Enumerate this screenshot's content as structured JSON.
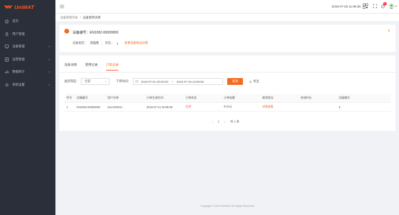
{
  "brand": {
    "name": "UniMAT",
    "color": "#ff5a1f"
  },
  "sidebar": {
    "items": [
      {
        "label": "首页",
        "icon": "home-icon",
        "has_children": false
      },
      {
        "label": "用户管理",
        "icon": "user-icon",
        "has_children": false
      },
      {
        "label": "设备管理",
        "icon": "device-icon",
        "has_children": true
      },
      {
        "label": "运营管理",
        "icon": "operation-icon",
        "has_children": true
      },
      {
        "label": "数据统计",
        "icon": "chart-icon",
        "has_children": true
      },
      {
        "label": "系统设置",
        "icon": "settings-icon",
        "has_children": true
      }
    ]
  },
  "header": {
    "datetime": "2019-07-25 11:06:36",
    "notification_count": "4"
  },
  "breadcrumb": {
    "items": [
      "设备管理列表",
      "设备使用详情"
    ]
  },
  "device": {
    "title": "设备编号：EN1002-00000000",
    "type_label": "设备类型：",
    "type_value": "充电柜",
    "status_label": "状态：",
    "status_value": "1",
    "address_link": "查看设备地址详情"
  },
  "tabs": [
    {
      "label": "设备详情",
      "active": false
    },
    {
      "label": "使用记录",
      "active": false
    },
    {
      "label": "订单记录",
      "active": true
    }
  ],
  "filter": {
    "type_label": "类型筛选：",
    "type_value": "全部",
    "date_label": "下单时间：",
    "date_start": "2019-07-01 00:00:00",
    "date_end": "2019-07-25 23:59:59",
    "query_button": "查询",
    "export_button": "导出"
  },
  "table": {
    "columns": [
      "序号",
      "设备编号",
      "用户名称",
      "订单生成时间",
      "订单状态",
      "订单金额",
      "使用地址",
      "充电时长",
      "设备模式"
    ],
    "rows": [
      [
        "1",
        "EN1002-00000000",
        "user100014",
        "2019-07-24 15:08:55",
        "已付",
        "0.01元",
        "详情查看",
        "",
        "3"
      ]
    ]
  },
  "pagination": {
    "current": "1",
    "total": "共 1 条"
  },
  "footer": {
    "copyright": "Copyright © 2019 UniMAT All Rights Reserved"
  }
}
